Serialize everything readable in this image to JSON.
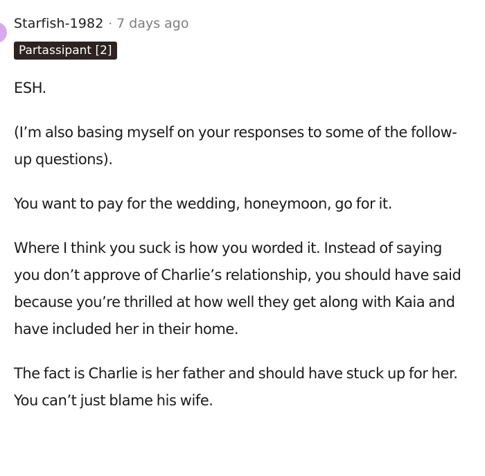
{
  "comment": {
    "author": "Starfish-1982",
    "separator": "·",
    "time_ago": "7 days ago",
    "flair": "Partassipant [2]",
    "paragraphs": [
      "ESH.",
      "(I’m also basing myself on your responses to some of the follow-up questions).",
      "You want to pay for the wedding, honeymoon, go for it.",
      "Where I think you suck is how you worded it. Instead of saying you don’t approve of Charlie’s relationship, you should have said because you’re thrilled at how well they get along with Kaia and have included her in their home.",
      "The fact is Charlie is her father and should have stuck up for her. You can’t just blame his wife."
    ]
  },
  "colors": {
    "flair_background": "#2d2320",
    "flair_text": "#ffffff",
    "meta_gray": "#7c7c7c",
    "avatar": "#d9a9f0"
  }
}
